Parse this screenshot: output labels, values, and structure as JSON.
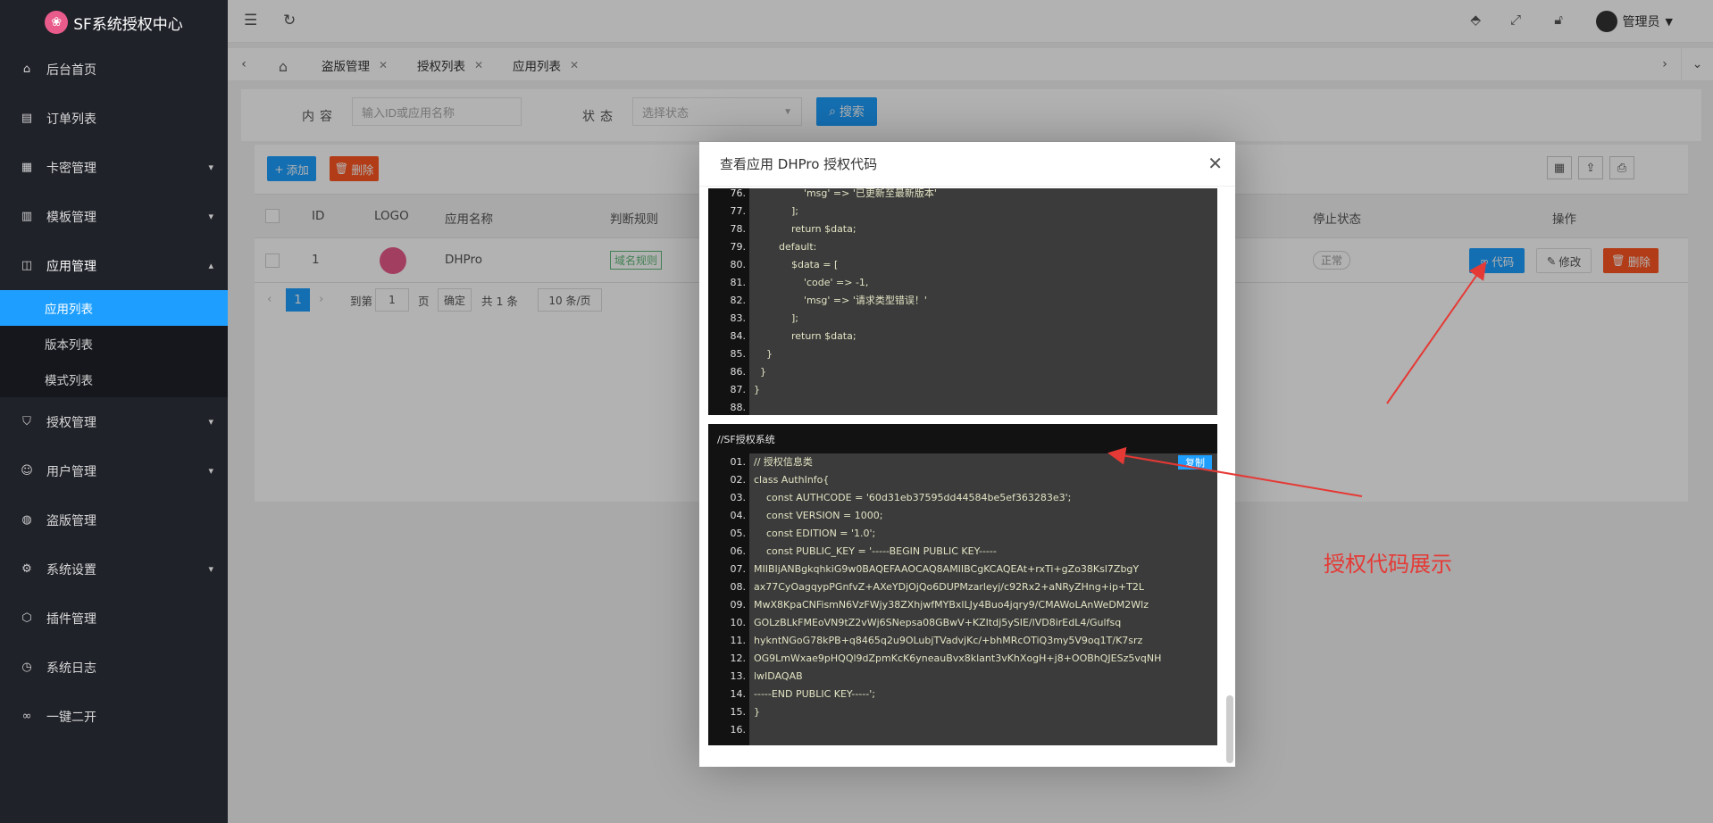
{
  "app": {
    "logo_text": "SF系统授权中心",
    "logo_icon": "lotus-icon"
  },
  "sidebar": {
    "items": [
      {
        "label": "后台首页",
        "icon": "home-icon"
      },
      {
        "label": "订单列表",
        "icon": "doc-icon"
      },
      {
        "label": "卡密管理",
        "icon": "grid-icon"
      },
      {
        "label": "模板管理",
        "icon": "template-icon"
      },
      {
        "label": "应用管理",
        "icon": "apps-icon"
      },
      {
        "label": "授权管理",
        "icon": "shield-icon"
      },
      {
        "label": "用户管理",
        "icon": "user-icon"
      },
      {
        "label": "盗版管理",
        "icon": "globe-icon"
      },
      {
        "label": "系统设置",
        "icon": "gear-icon"
      },
      {
        "label": "插件管理",
        "icon": "plugin-icon"
      },
      {
        "label": "系统日志",
        "icon": "clock-icon"
      },
      {
        "label": "一键二开",
        "icon": "link-icon"
      }
    ],
    "sub_items": [
      "应用列表",
      "版本列表",
      "模式列表"
    ]
  },
  "topbar": {
    "user": "管理员"
  },
  "tabs": [
    "盗版管理",
    "授权列表",
    "应用列表"
  ],
  "filter": {
    "content_label": "内容",
    "content_placeholder": "输入ID或应用名称",
    "status_label": "状态",
    "status_placeholder": "选择状态",
    "search_label": "搜索"
  },
  "toolbar": {
    "add_label": "添加",
    "delete_label": "删除"
  },
  "table": {
    "headers": {
      "id": "ID",
      "logo": "LOGO",
      "name": "应用名称",
      "rule": "判断规则",
      "stop": "停止状态",
      "ops": "操作"
    },
    "row": {
      "id": "1",
      "name": "DHPro",
      "rule": "域名规则",
      "stop": "正常"
    },
    "ops": {
      "code": "代码",
      "edit": "修改",
      "delete": "删除"
    }
  },
  "pager": {
    "page": "1",
    "goto_label": "到第",
    "goto_value": "1",
    "page_unit": "页",
    "confirm": "确定",
    "total": "共 1 条",
    "page_size": "10 条/页"
  },
  "modal": {
    "title": "查看应用 DHPro 授权代码",
    "code1": [
      {
        "n": "76.",
        "t": "                'msg' => '已更新至最新版本'"
      },
      {
        "n": "77.",
        "t": "            ];"
      },
      {
        "n": "78.",
        "t": "            return $data;"
      },
      {
        "n": "79.",
        "t": "        default:"
      },
      {
        "n": "80.",
        "t": "            $data = ["
      },
      {
        "n": "81.",
        "t": "                'code' => -1,"
      },
      {
        "n": "82.",
        "t": "                'msg' => '请求类型错误！'"
      },
      {
        "n": "83.",
        "t": "            ];"
      },
      {
        "n": "84.",
        "t": "            return $data;"
      },
      {
        "n": "85.",
        "t": "    }"
      },
      {
        "n": "86.",
        "t": "  }"
      },
      {
        "n": "87.",
        "t": "}"
      },
      {
        "n": "88.",
        "t": ""
      }
    ],
    "code2_title": "//SF授权系统",
    "copy_label": "复制",
    "code2": [
      {
        "n": "01.",
        "t": "// 授权信息类"
      },
      {
        "n": "02.",
        "t": "class AuthInfo{"
      },
      {
        "n": "03.",
        "t": "    const AUTHCODE = '60d31eb37595dd44584be5ef363283e3';"
      },
      {
        "n": "04.",
        "t": "    const VERSION = 1000;"
      },
      {
        "n": "05.",
        "t": "    const EDITION = '1.0';"
      },
      {
        "n": "06.",
        "t": "    const PUBLIC_KEY = '-----BEGIN PUBLIC KEY-----"
      },
      {
        "n": "07.",
        "t": "MIIBIjANBgkqhkiG9w0BAQEFAAOCAQ8AMIIBCgKCAQEAt+rxTi+gZo38Ksl7ZbgY"
      },
      {
        "n": "08.",
        "t": "ax77CyOagqypPGnfvZ+AXeYDjOjQo6DUPMzarleyj/c92Rx2+aNRyZHng+ip+T2L"
      },
      {
        "n": "09.",
        "t": "MwX8KpaCNFismN6VzFWjy38ZXhjwfMYBxlLJy4Buo4jqry9/CMAWoLAnWeDM2Wlz"
      },
      {
        "n": "10.",
        "t": "GOLzBLkFMEoVN9tZ2vWj6SNepsa08GBwV+KZItdj5ySIE/lVD8irEdL4/Gulfsq"
      },
      {
        "n": "11.",
        "t": "hykntNGoG78kPB+q8465q2u9OLubjTVadvjKc/+bhMRcOTiQ3my5V9oq1T/K7srz"
      },
      {
        "n": "12.",
        "t": "OG9LmWxae9pHQQl9dZpmKcK6yneauBvx8klant3vKhXogH+j8+OOBhQJESz5vqNH"
      },
      {
        "n": "13.",
        "t": "lwIDAQAB"
      },
      {
        "n": "14.",
        "t": "-----END PUBLIC KEY-----';"
      },
      {
        "n": "15.",
        "t": "}"
      },
      {
        "n": "16.",
        "t": ""
      }
    ]
  },
  "annotation": "授权代码展示",
  "colors": {
    "primary": "#1e9fff",
    "danger": "#ff5722",
    "sidebar": "#20222a",
    "arrow": "#e53935"
  }
}
